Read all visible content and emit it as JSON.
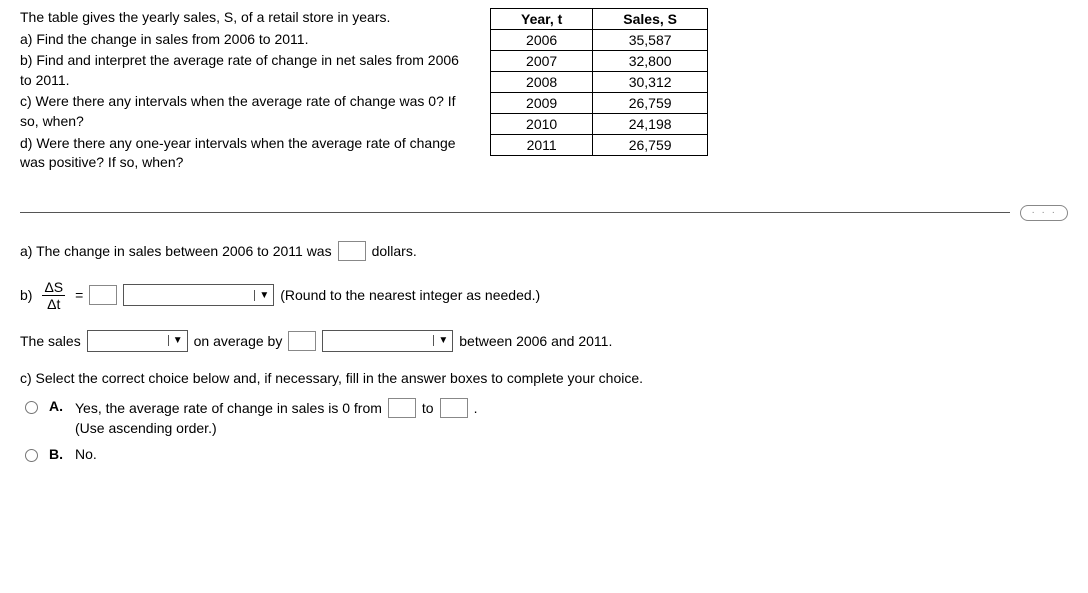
{
  "intro": "The table gives the yearly sales, S, of a retail store in years.",
  "parts": {
    "a": "a) Find the change in sales from 2006 to 2011.",
    "b": "b) Find and interpret the average rate of change in net sales from 2006 to 2011.",
    "c": "c) Were there any intervals when the average rate of change was 0? If so, when?",
    "d": "d) Were there any one-year intervals when the average rate of change was positive? If so, when?"
  },
  "table": {
    "head_t": "Year, t",
    "head_s": "Sales, S",
    "rows": [
      {
        "t": "2006",
        "s": "35,587"
      },
      {
        "t": "2007",
        "s": "32,800"
      },
      {
        "t": "2008",
        "s": "30,312"
      },
      {
        "t": "2009",
        "s": "26,759"
      },
      {
        "t": "2010",
        "s": "24,198"
      },
      {
        "t": "2011",
        "s": "26,759"
      }
    ]
  },
  "pill": "· · ·",
  "answers": {
    "a_pre": "a) The change in sales between 2006 to 2011 was",
    "a_post": "dollars.",
    "b_label": "b)",
    "frac_num": "ΔS",
    "frac_den": "Δt",
    "eq": "=",
    "round_note": "(Round to the nearest integer as needed.)",
    "interp_pre": "The sales",
    "interp_mid": "on average by",
    "interp_post": "between 2006 and 2011.",
    "c_prompt": "c) Select the correct choice below and, if necessary, fill in the answer boxes to complete your choice.",
    "optA_letter": "A.",
    "optA_pre": "Yes, the average rate of change in sales is 0 from",
    "optA_mid": "to",
    "optA_post": ".",
    "optA_note": "(Use ascending order.)",
    "optB_letter": "B.",
    "optB_text": "No."
  }
}
